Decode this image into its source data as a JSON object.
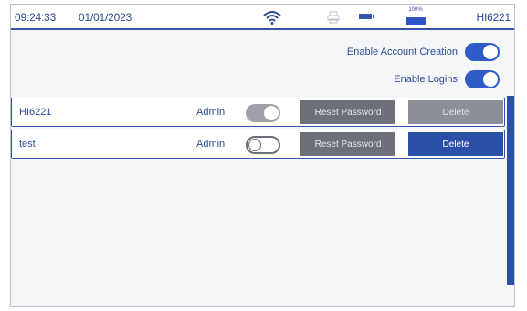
{
  "status_bar": {
    "time": "09:24:33",
    "date": "01/01/2023",
    "battery_percent_label": "100%",
    "device_name": "HI6221",
    "icons": [
      "wifi-icon",
      "printer-icon",
      "battery-small-icon",
      "battery-icon"
    ]
  },
  "settings": {
    "enable_account_creation": {
      "label": "Enable Account Creation",
      "state": "on"
    },
    "enable_logins": {
      "label": "Enable Logins",
      "state": "on"
    }
  },
  "users": [
    {
      "username": "HI6221",
      "role": "Admin",
      "toggle_state": "disabled-on",
      "reset_label": "Reset Password",
      "delete_label": "Delete",
      "delete_enabled": false
    },
    {
      "username": "test",
      "role": "Admin",
      "toggle_state": "off",
      "reset_label": "Reset Password",
      "delete_label": "Delete",
      "delete_enabled": true
    }
  ],
  "colors": {
    "accent": "#2f5bc7",
    "text": "#2f4b9a",
    "disabled_button": "#6d7078",
    "delete_active": "#2c4fa8"
  }
}
